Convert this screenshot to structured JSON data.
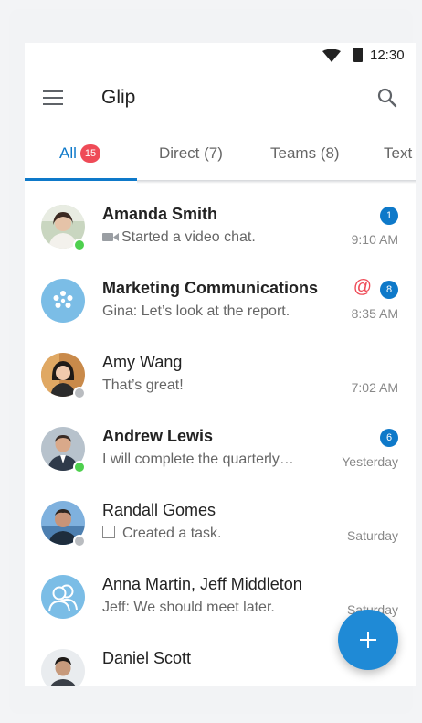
{
  "status_bar": {
    "time": "12:30",
    "wifi_icon": "wifi-icon",
    "battery_icon": "battery-icon"
  },
  "app_bar": {
    "title": "Glip",
    "menu_icon": "menu-icon",
    "search_icon": "search-icon"
  },
  "tabs": [
    {
      "label": "All",
      "badge": "15",
      "active": true
    },
    {
      "label": "Direct (7)"
    },
    {
      "label": "Teams (8)"
    },
    {
      "label": "Text"
    }
  ],
  "conversations": [
    {
      "name": "Amanda Smith",
      "preview": "Started a video chat.",
      "time": "9:10 AM",
      "unread": "1",
      "presence": "online",
      "icon": "video-icon"
    },
    {
      "name": "Marketing Communications",
      "preview": "Gina: Let’s look at the report.",
      "time": "8:35 AM",
      "unread": "8",
      "mention": "@",
      "icon": "team-icon"
    },
    {
      "name": "Amy Wang",
      "preview": "That’s great!",
      "time": "7:02 AM",
      "presence": "offline"
    },
    {
      "name": "Andrew Lewis",
      "preview": "I will complete the quarterly…",
      "time": "Yesterday",
      "unread": "6",
      "presence": "online"
    },
    {
      "name": "Randall Gomes",
      "preview": "Created a task.",
      "time": "Saturday",
      "presence": "offline",
      "icon": "task-icon"
    },
    {
      "name": "Anna Martin, Jeff Middleton",
      "preview": "Jeff: We should meet later.",
      "time": "Saturday",
      "icon": "group-icon"
    },
    {
      "name": "Daniel Scott",
      "preview": "",
      "time": ""
    }
  ],
  "fab": {
    "icon": "plus-icon"
  },
  "colors": {
    "accent": "#0e79c9",
    "badge_red": "#ef4b57",
    "online": "#4ed04e",
    "fab": "#1f8ad6"
  }
}
